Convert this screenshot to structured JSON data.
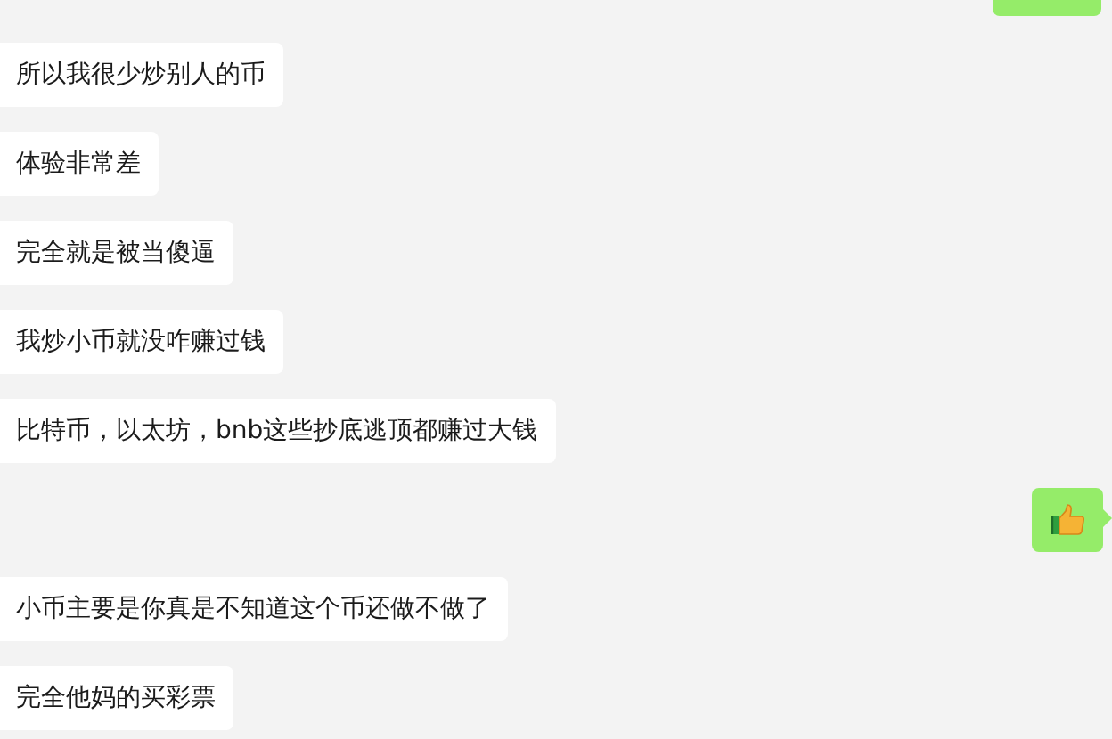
{
  "messages": [
    {
      "sent": true,
      "kind": "partial"
    },
    {
      "sent": false,
      "kind": "text",
      "text": "所以我很少炒别人的币"
    },
    {
      "sent": false,
      "kind": "text",
      "text": "体验非常差"
    },
    {
      "sent": false,
      "kind": "text",
      "text": "完全就是被当傻逼"
    },
    {
      "sent": false,
      "kind": "text",
      "text": "我炒小币就没咋赚过钱"
    },
    {
      "sent": false,
      "kind": "text",
      "text": "比特币，以太坊，bnb这些抄底逃顶都赚过大钱"
    },
    {
      "sent": true,
      "kind": "emoji"
    },
    {
      "sent": false,
      "kind": "text",
      "text": "小币主要是你真是不知道这个币还做不做了"
    },
    {
      "sent": false,
      "kind": "text",
      "text": "完全他妈的买彩票"
    }
  ]
}
